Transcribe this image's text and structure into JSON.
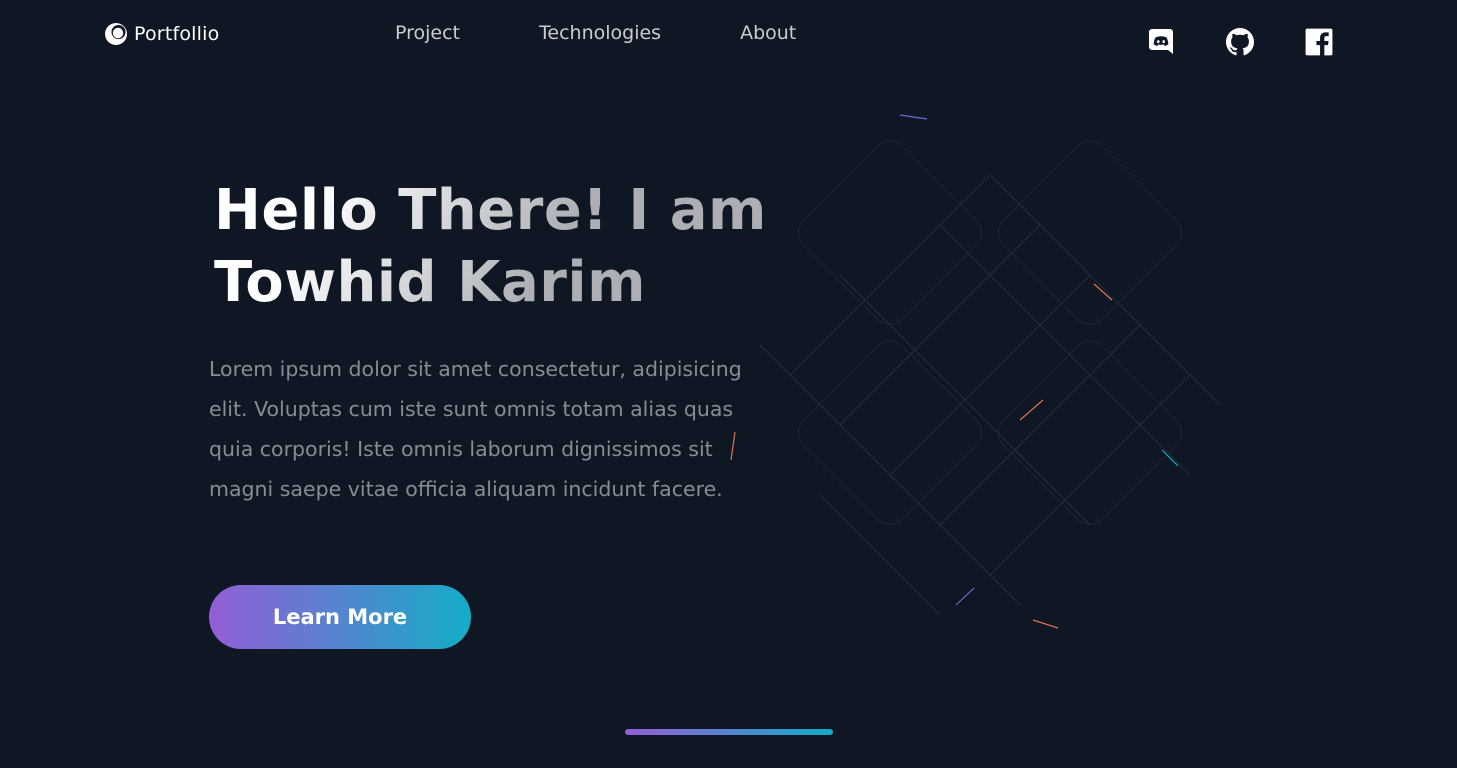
{
  "header": {
    "logo_text": "Portfollio",
    "logo_icon": "portfolio-logo-icon",
    "nav": [
      {
        "label": "Project"
      },
      {
        "label": "Technologies"
      },
      {
        "label": "About"
      }
    ],
    "socials": [
      {
        "icon": "discord-icon"
      },
      {
        "icon": "github-icon"
      },
      {
        "icon": "facebook-icon"
      }
    ]
  },
  "hero": {
    "title_line1": "Hello There! I am",
    "title_line2": "Towhid Karim",
    "description": "Lorem ipsum dolor sit amet consectetur, adipisicing elit. Voluptas cum iste sunt omnis totam alias quas quia corporis! Iste omnis laborum dignissimos sit magni saepe vitae officia aliquam incidunt facere.",
    "cta_label": "Learn More"
  },
  "colors": {
    "background": "#0f1624",
    "gradient_start": "#945DD6",
    "gradient_end": "#13ADC7",
    "text_muted": "rgba(255,255,255,0.5)"
  }
}
